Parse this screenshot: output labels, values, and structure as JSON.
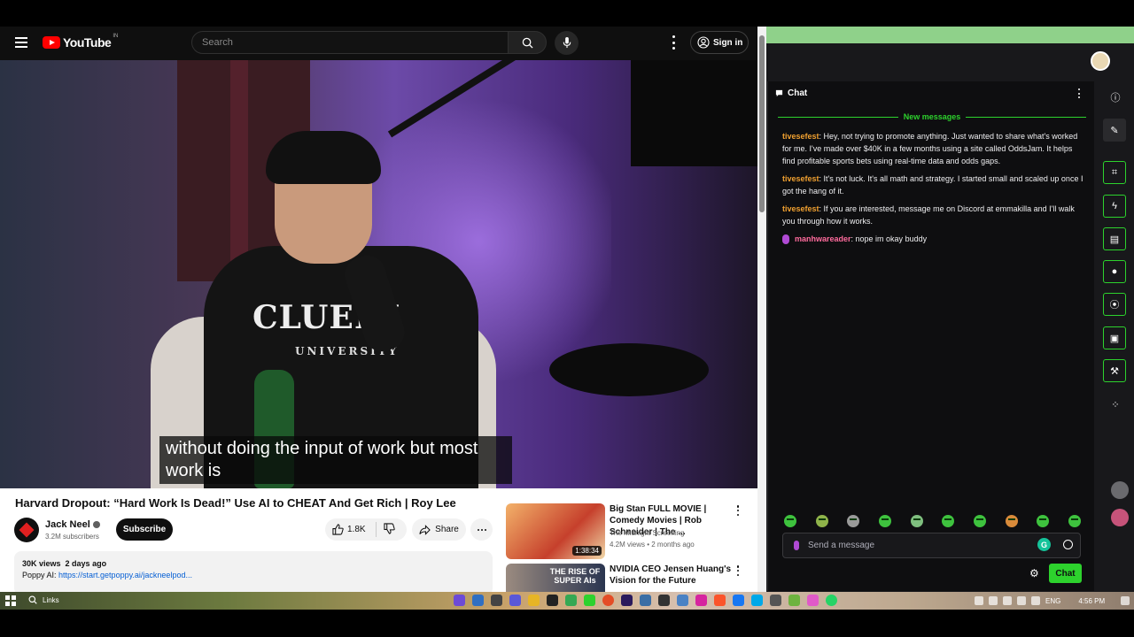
{
  "youtube": {
    "logo_text": "YouTube",
    "logo_region": "IN",
    "search_placeholder": "Search",
    "sign_in_label": "Sign in",
    "caption": "without doing the input of work but most work is",
    "hoodie_text": "CLUELY",
    "hoodie_subtext": "UNIVERSITY",
    "video_title": "Harvard Dropout: “Hard Work Is Dead!” Use AI to CHEAT And Get Rich | Roy Lee",
    "channel_name": "Jack Neel",
    "subscribers": "3.2M subscribers",
    "subscribe_label": "Subscribe",
    "likes": "1.8K",
    "share_label": "Share",
    "description": {
      "views": "30K views",
      "date": "2 days ago",
      "prefix": "Poppy AI: ",
      "link": "https://start.getpoppy.ai/jackneelpod..."
    },
    "recommendations": [
      {
        "title": "Big Stan FULL MOVIE | Comedy Movies | Rob Schneider | The ...",
        "channel": "The Midnight Screening",
        "meta": "4.2M views • 2 months ago",
        "duration": "1:38:34",
        "thumb_color": "#d9843a"
      },
      {
        "title": "NVIDIA CEO Jensen Huang's Vision for the Future",
        "thumb_text": "THE RISE OF SUPER AIs",
        "thumb_color": "#2a3550"
      }
    ]
  },
  "chat": {
    "header": "Chat",
    "divider": "New messages",
    "messages": [
      {
        "user": "tivesefest",
        "text": ": Hey, not trying to promote anything. Just wanted to share what's worked for me. I've made over $40K in a few months using a site called OddsJam. It helps find profitable sports bets using real-time data and odds gaps."
      },
      {
        "user": "tivesefest",
        "text": ": It's not luck. It's all math and strategy. I started small and scaled up once I got the hang of it."
      },
      {
        "user": "tivesefest",
        "text": ": If you are interested, message me on Discord at emmakilla and I'll walk you through how it works."
      },
      {
        "user": "manhwareader",
        "text": ": nope im okay buddy"
      }
    ],
    "input_placeholder": "Send a message",
    "send_label": "Chat",
    "grammarly_letter": "G",
    "accent_color": "#2dd22d"
  },
  "taskbar": {
    "search_label": "Links",
    "language": "ENG",
    "time": "4:56 PM"
  }
}
